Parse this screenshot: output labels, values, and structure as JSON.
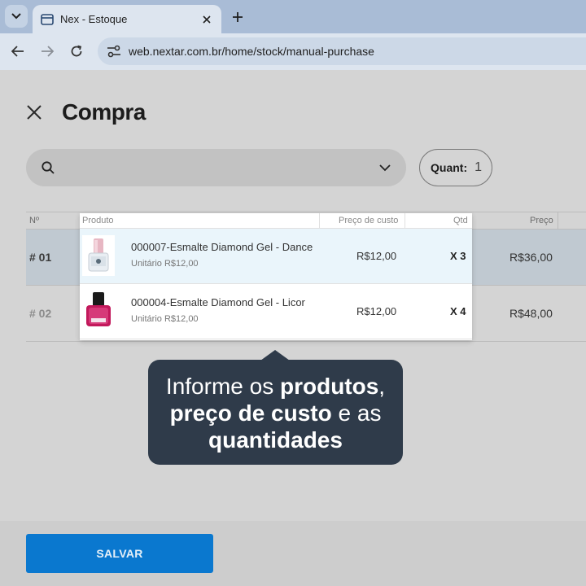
{
  "browser": {
    "tab_title": "Nex - Estoque",
    "url": "web.nextar.com.br/home/stock/manual-purchase"
  },
  "page": {
    "title": "Compra",
    "search": {
      "placeholder": ""
    },
    "quant": {
      "label": "Quant:",
      "value": "1"
    }
  },
  "table": {
    "columns": {
      "number": "Nº",
      "product": "Produto",
      "cost": "Preço de custo",
      "qty": "Qtd",
      "price": "Preço"
    },
    "rows": [
      {
        "number": "# 01",
        "product": "000007-Esmalte Diamond Gel - Dance",
        "unit": "Unitário R$12,00",
        "cost": "R$12,00",
        "qty": "X 3",
        "price": "R$36,00"
      },
      {
        "number": "# 02",
        "product": "000004-Esmalte Diamond Gel - Licor",
        "unit": "Unitário R$12,00",
        "cost": "R$12,00",
        "qty": "X 4",
        "price": "R$48,00"
      }
    ]
  },
  "tooltip": {
    "line1_normal": "Informe os ",
    "line1_bold": "produtos",
    "line1_end": ",",
    "line2_bold": "preço de custo",
    "line2_normal": " e as",
    "line3_bold": "quantidades"
  },
  "footer": {
    "save_label": "SALVAR"
  },
  "colors": {
    "accent": "#0a78cf",
    "tooltip_bg": "#2f3b4a",
    "overlay": "#d4d4d4"
  }
}
